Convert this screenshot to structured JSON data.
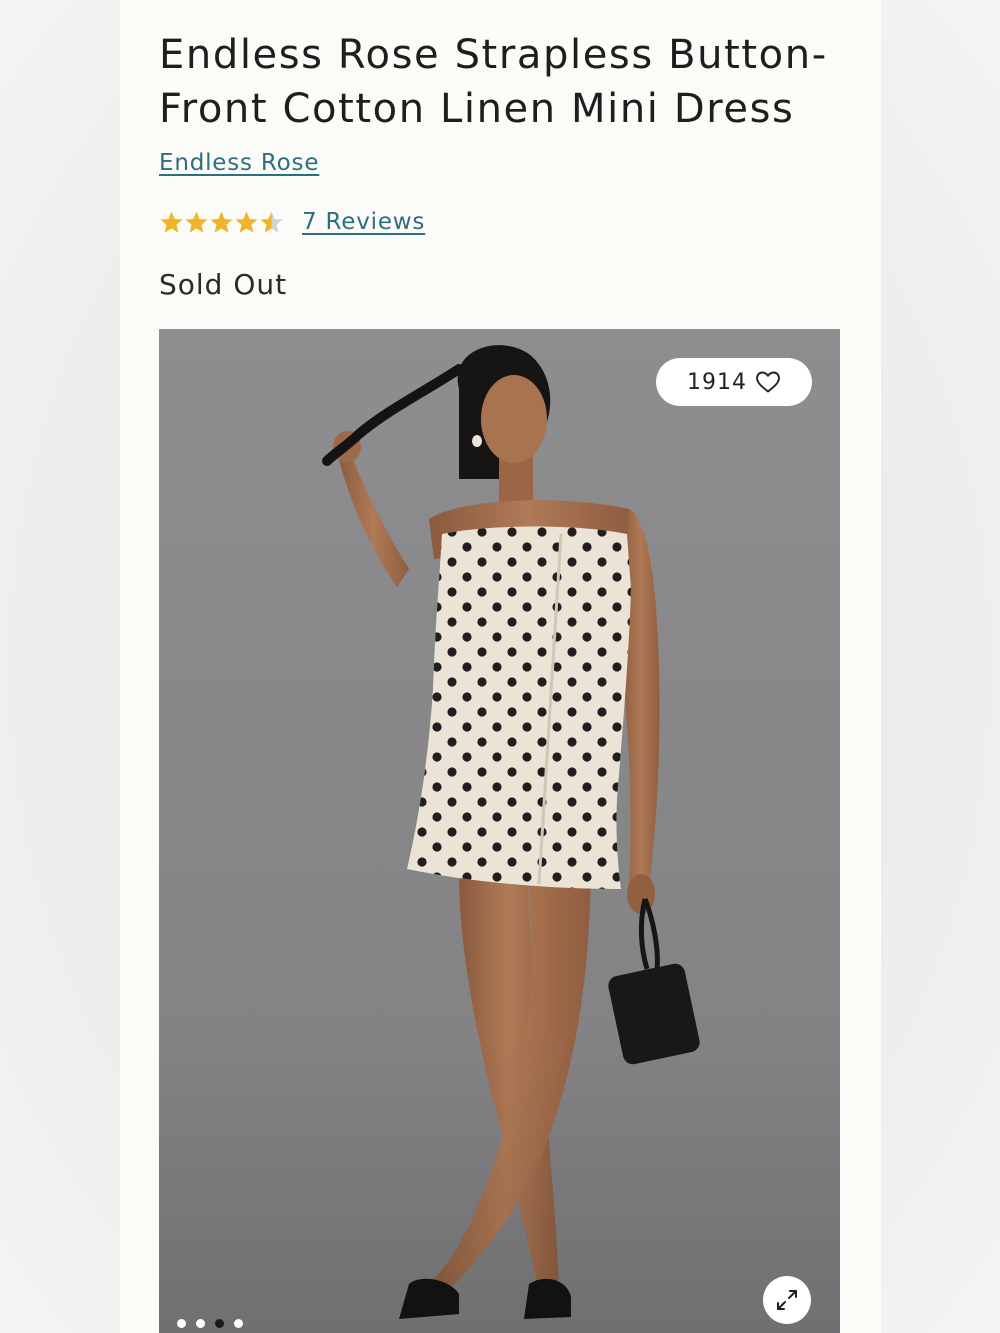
{
  "product": {
    "title": "Endless Rose Strapless Button-Front Cotton Linen Mini Dress",
    "brand": "Endless Rose",
    "rating": 4.5,
    "rating_max": 5,
    "reviews_label": "7 Reviews",
    "stock_status": "Sold Out"
  },
  "gallery": {
    "like_count": "1914",
    "heart_icon": "heart-outline-icon",
    "expand_icon": "expand-arrows-icon",
    "dots_total": 4,
    "active_dot": 2
  },
  "colors": {
    "star": "#f0b42a",
    "star_empty": "#cfd2d6",
    "link": "#2d6e80",
    "background": "#8a898b"
  }
}
